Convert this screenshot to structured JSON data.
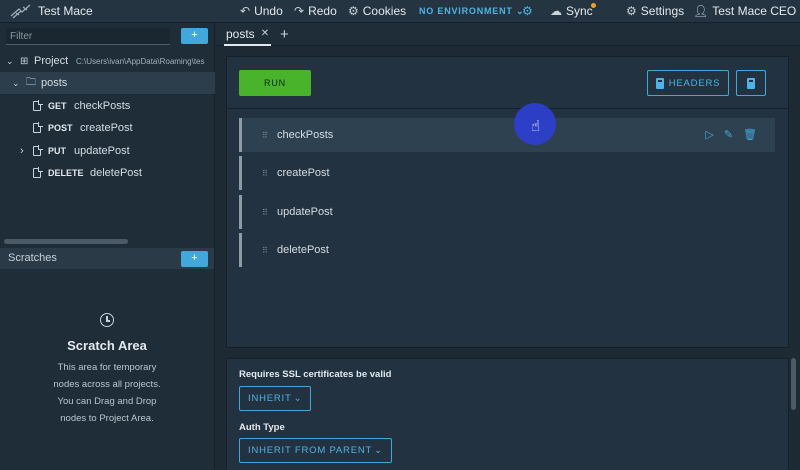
{
  "app": {
    "title": "Test Mace",
    "undo": "Undo",
    "redo": "Redo",
    "cookies": "Cookies",
    "environment": "NO ENVIRONMENT",
    "sync": "Sync",
    "settings": "Settings",
    "user": "Test Mace CEO"
  },
  "sidebar": {
    "filter_placeholder": "Filter",
    "add_label": "+",
    "project": {
      "label": "Project",
      "path": "C:\\Users\\ivan\\AppData\\Roaming\\tes"
    },
    "folder": "posts",
    "items": [
      {
        "method": "GET",
        "name": "checkPosts"
      },
      {
        "method": "POST",
        "name": "createPost"
      },
      {
        "method": "PUT",
        "name": "updatePost"
      },
      {
        "method": "DELETE",
        "name": "deletePost"
      }
    ]
  },
  "scratches": {
    "header": "Scratches",
    "add_label": "+",
    "title": "Scratch Area",
    "desc_lines": [
      "This area for temporary",
      "nodes across all projects.",
      "You can Drag and Drop",
      "nodes to Project Area."
    ]
  },
  "tabs": {
    "active": "posts",
    "add": "+"
  },
  "editor": {
    "run_label": "RUN",
    "headers_label": "HEADERS",
    "requests": [
      "checkPosts",
      "createPost",
      "updatePost",
      "deletePost"
    ]
  },
  "options": {
    "ssl_label": "Requires SSL certificates be valid",
    "ssl_value": "INHERIT",
    "auth_label": "Auth Type",
    "auth_value": "INHERIT FROM PARENT"
  },
  "colors": {
    "accent": "#42a8dc",
    "run": "#4ab32c",
    "sync_dot": "#f0a020",
    "cursor_highlight": "#2c3fd0"
  }
}
